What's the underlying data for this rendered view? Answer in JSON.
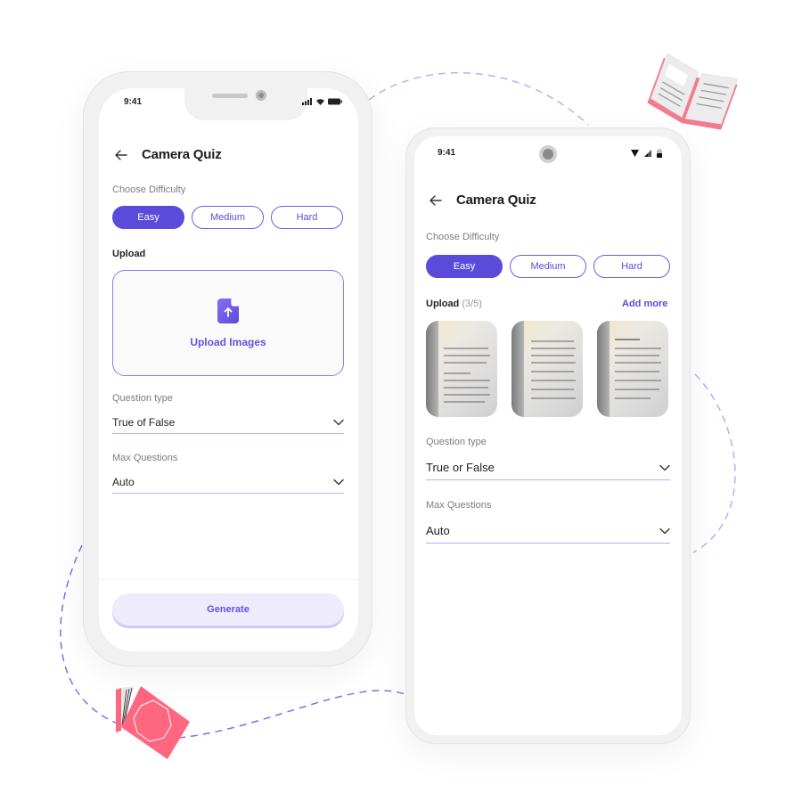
{
  "colors": {
    "accent": "#5b4bdb",
    "accent_light": "#eeebfd",
    "book_pink": "#ff6680",
    "dash": "#8f84f0"
  },
  "phone_ios": {
    "status": {
      "time": "9:41",
      "icons": [
        "signal-icon",
        "wifi-icon",
        "battery-icon"
      ]
    },
    "header": {
      "back_icon": "arrow-left-icon",
      "title": "Camera Quiz"
    },
    "difficulty": {
      "label": "Choose Difficulty",
      "options": [
        {
          "label": "Easy",
          "selected": true
        },
        {
          "label": "Medium",
          "selected": false
        },
        {
          "label": "Hard",
          "selected": false
        }
      ]
    },
    "upload": {
      "label": "Upload",
      "icon": "file-upload-icon",
      "button_label": "Upload Images"
    },
    "question_type": {
      "label": "Question type",
      "value": "True of False"
    },
    "max_questions": {
      "label": "Max Questions",
      "value": "Auto"
    },
    "generate_label": "Generate"
  },
  "phone_android": {
    "status": {
      "time": "9:41",
      "icons": [
        "wifi-icon",
        "signal-icon",
        "battery-icon"
      ]
    },
    "header": {
      "back_icon": "arrow-left-icon",
      "title": "Camera Quiz"
    },
    "difficulty": {
      "label": "Choose Difficulty",
      "options": [
        {
          "label": "Easy",
          "selected": true
        },
        {
          "label": "Medium",
          "selected": false
        },
        {
          "label": "Hard",
          "selected": false
        }
      ]
    },
    "upload": {
      "label": "Upload",
      "count": "(3/5)",
      "add_more_label": "Add more",
      "images": [
        "book-page-photo-1",
        "book-page-photo-2",
        "book-page-photo-3"
      ]
    },
    "question_type": {
      "label": "Question type",
      "value": "True or False"
    },
    "max_questions": {
      "label": "Max Questions",
      "value": "Auto"
    }
  },
  "decorations": [
    "open-book-illustration",
    "closed-book-illustration",
    "dashed-path"
  ]
}
